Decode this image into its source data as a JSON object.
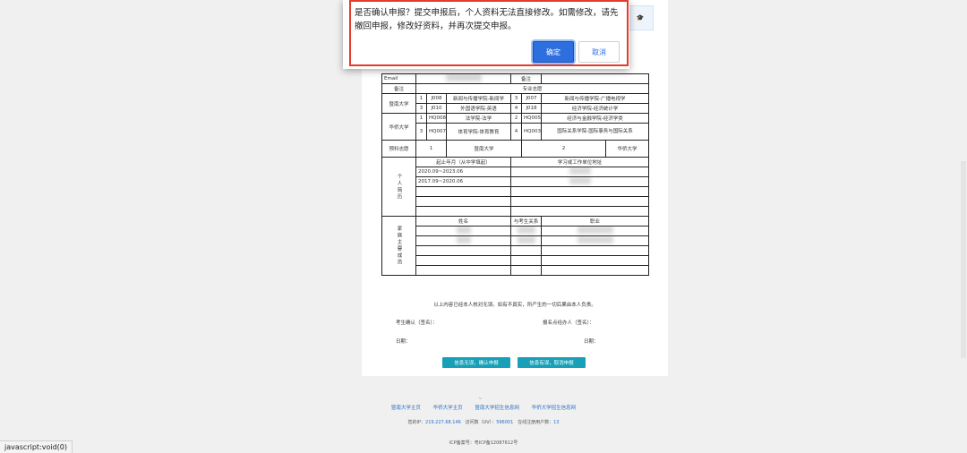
{
  "dialog": {
    "message": "是否确认申报？提交申报后，个人资料无法直接修改。如需修改，请先撤回申报，修改好资料，并再次提交申报。",
    "confirm_label": "确定",
    "cancel_label": "取消"
  },
  "form": {
    "email_label": "Email",
    "note_label": "备注",
    "remark_label": "备注",
    "major_header": "专业志愿",
    "schools": [
      {
        "name": "暨南大学",
        "rows": [
          {
            "a_no": "1",
            "a_code": "J008",
            "a_name": "新闻与传播学院-新闻学",
            "b_no": "3",
            "b_code": "J007",
            "b_name": "新闻与传播学院-广播电视学"
          },
          {
            "a_no": "3",
            "a_code": "J010",
            "a_name": "外国语学院-英语",
            "b_no": "4",
            "b_code": "J018",
            "b_name": "经济学院-经济统计学"
          }
        ]
      },
      {
        "name": "华侨大学",
        "rows": [
          {
            "a_no": "1",
            "a_code": "HQ008",
            "a_name": "法学院-法学",
            "b_no": "2",
            "b_code": "HQ005",
            "b_name": "经济与金融学院-经济学类"
          },
          {
            "a_no": "3",
            "a_code": "HQ007",
            "a_name": "体育学院-体育教育",
            "b_no": "4",
            "b_code": "HQ003",
            "b_name": "国际关系学院-国际事务与国际关系"
          }
        ]
      }
    ],
    "preference": {
      "label": "预科志愿",
      "first_no": "1",
      "first_name": "暨南大学",
      "second_no": "2",
      "second_name": "华侨大学"
    },
    "resume": {
      "side_label": "个人简历",
      "col1": "起止年月（从中学填起）",
      "col2": "学习或工作单位地址",
      "rows": [
        "2020.09~2023.06",
        "2017.09~2020.06"
      ]
    },
    "family": {
      "side_label": "家庭主要成员",
      "col1": "姓名",
      "col2": "与考生关系",
      "col3": "职业"
    }
  },
  "notes": {
    "declaration": "以上内容已经本人核对无误。如有不真实，所产生的一切后果由本人负责。",
    "candidate_sign": "考生确认（签名）：",
    "handler_sign": "报名点经办人（签名）：",
    "date_left": "日期：",
    "date_right": "日期："
  },
  "actions": {
    "confirm_submit": "信息无误，确认申报",
    "withdraw": "信息有误，取消申报"
  },
  "footer": {
    "links": [
      "暨南大学主页",
      "华侨大学主页",
      "暨南大学招生信息网",
      "华侨大学招生信息网"
    ],
    "ip_label": "您的IP：",
    "ip_value": "219.227.68.146",
    "visits_label": "访问数（UV）：",
    "visits_value": "596001",
    "online_label": "在线注册用户数：",
    "online_value": "13",
    "icp": "ICP备案号：粤ICP备12087612号"
  },
  "statusbar": {
    "text": "javascript:void(0)"
  }
}
